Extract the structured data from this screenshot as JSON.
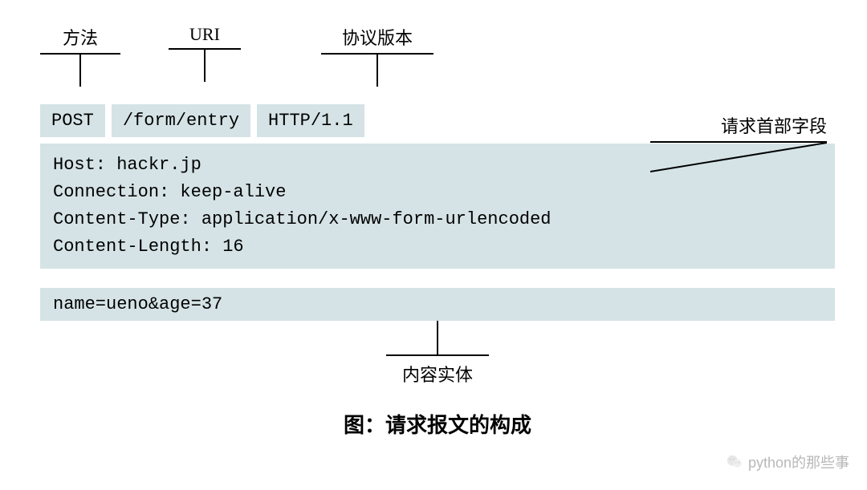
{
  "labels": {
    "method": "方法",
    "uri": "URI",
    "protocol": "协议版本",
    "request_headers": "请求首部字段",
    "body": "内容实体"
  },
  "request_line": {
    "method": "POST",
    "uri": "/form/entry",
    "protocol": "HTTP/1.1"
  },
  "headers": [
    "Host: hackr.jp",
    "Connection: keep-alive",
    "Content-Type: application/x-www-form-urlencoded",
    "Content-Length: 16"
  ],
  "body": "name=ueno&age=37",
  "caption": "图：请求报文的构成",
  "watermark": "python的那些事"
}
